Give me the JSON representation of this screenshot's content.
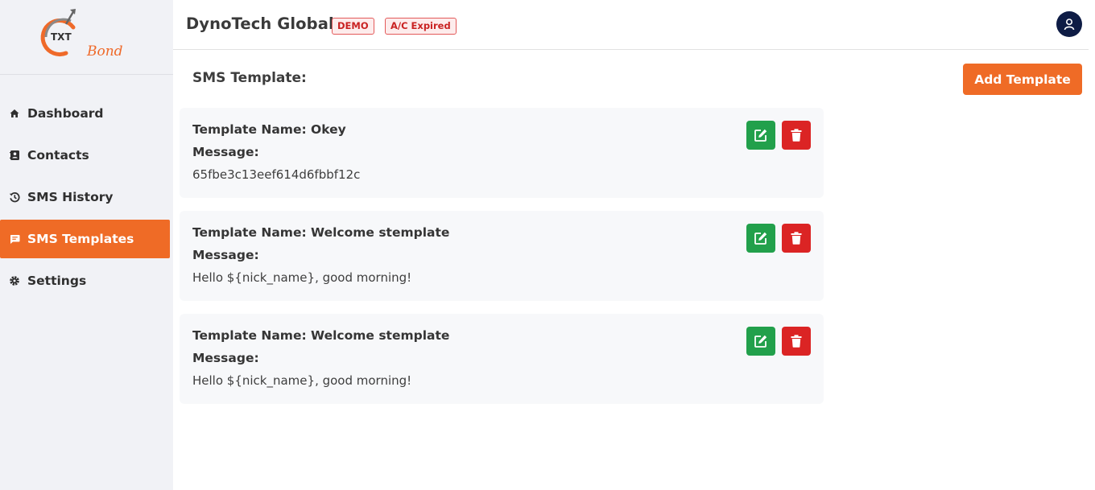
{
  "brand": {
    "logo_text": "TXT",
    "logo_word": "Bond",
    "accent_color": "#ef6b26",
    "nav_color": "#0e1c45"
  },
  "sidebar": {
    "items": [
      {
        "label": "Dashboard",
        "icon": "home-icon",
        "active": false
      },
      {
        "label": "Contacts",
        "icon": "contacts-icon",
        "active": false
      },
      {
        "label": "SMS History",
        "icon": "history-icon",
        "active": false
      },
      {
        "label": "SMS Templates",
        "icon": "message-icon",
        "active": true
      },
      {
        "label": "Settings",
        "icon": "gear-icon",
        "active": false
      }
    ]
  },
  "header": {
    "company": "DynoTech Global",
    "badges": [
      "DEMO",
      "A/C Expired"
    ],
    "user_icon": "user-icon"
  },
  "main": {
    "title": "SMS Template:",
    "add_button": "Add Template",
    "templates": [
      {
        "name_line": "Template Name: Okey",
        "message_label": "Message:",
        "message": "65fbe3c13eef614d6fbbf12c"
      },
      {
        "name_line": "Template Name: Welcome stemplate",
        "message_label": "Message:",
        "message": "Hello ${nick_name}, good morning!"
      },
      {
        "name_line": "Template Name: Welcome stemplate",
        "message_label": "Message:",
        "message": "Hello ${nick_name}, good morning!"
      }
    ],
    "edit_icon": "edit-icon",
    "delete_icon": "trash-icon",
    "edit_color": "#22a04b",
    "delete_color": "#db2424"
  }
}
